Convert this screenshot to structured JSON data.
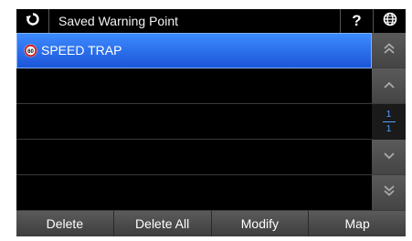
{
  "header": {
    "title": "Saved Warning Point",
    "back_icon": "refresh-back-icon",
    "help_label": "?",
    "globe_icon": "globe-icon"
  },
  "list": {
    "items": [
      {
        "label": "SPEED TRAP",
        "icon": "speed-limit-60-icon",
        "icon_text": "60",
        "selected": true
      },
      {
        "label": ""
      },
      {
        "label": ""
      },
      {
        "label": ""
      },
      {
        "label": ""
      }
    ]
  },
  "pagination": {
    "current": "1",
    "total": "1"
  },
  "scroll_icons": [
    "double-chevron-up-icon",
    "chevron-up-icon",
    "chevron-down-icon",
    "double-chevron-down-icon"
  ],
  "actions": {
    "delete": "Delete",
    "delete_all": "Delete All",
    "modify": "Modify",
    "map": "Map"
  },
  "colors": {
    "selected_row": "#2f6ff0",
    "page_indicator": "#4ea2ff",
    "background": "#000000"
  }
}
